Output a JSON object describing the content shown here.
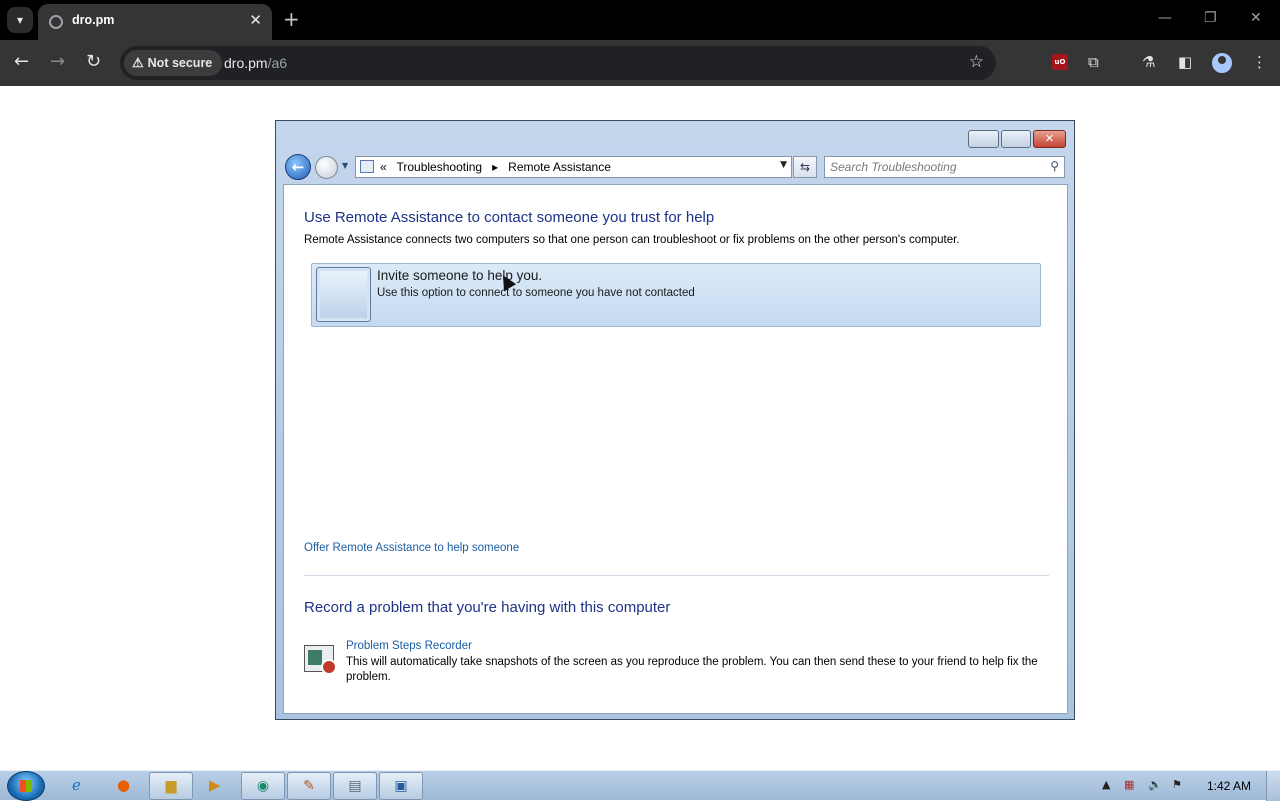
{
  "browser": {
    "tab_title": "dro.pm",
    "new_tab_glyph": "+",
    "close_glyph": "✕",
    "security_label": "Not secure",
    "url_host": "dro.pm",
    "url_path": "/a6"
  },
  "window": {
    "breadcrumb_prefix": "«",
    "breadcrumb_1": "Troubleshooting",
    "breadcrumb_sep": "▸",
    "breadcrumb_2": "Remote Assistance",
    "search_placeholder": "Search Troubleshooting"
  },
  "content": {
    "heading1": "Use Remote Assistance to contact someone you trust for help",
    "description": "Remote Assistance connects two computers so that one person can troubleshoot or fix problems on the other person's computer.",
    "invite_title": "Invite someone to help you.",
    "invite_subtitle": "Use this option to connect to someone you have not contacted",
    "offer_link": "Offer Remote Assistance to help someone",
    "heading2": "Record a problem that you're having with this computer",
    "psr_title": "Problem Steps Recorder",
    "psr_description": "This will automatically take snapshots of the screen as you reproduce the problem. You can then send these to your friend to help fix the problem."
  },
  "taskbar": {
    "clock": "1:42 AM"
  },
  "colors": {
    "heading": "#1e3287",
    "link": "#1a5ea3",
    "chrome_bg": "#353535",
    "invite_bg": "#c5daf0"
  }
}
